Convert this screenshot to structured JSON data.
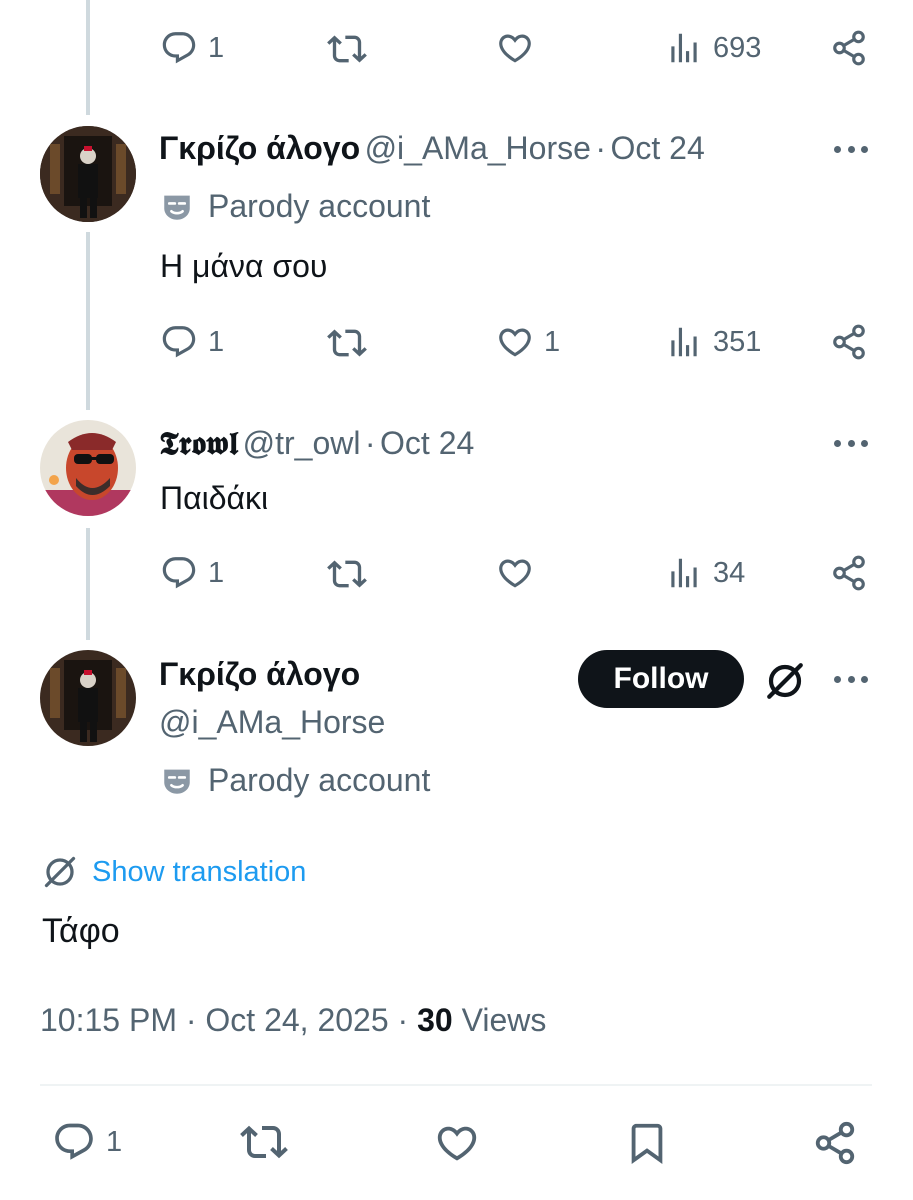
{
  "top_actions": {
    "replies": "1",
    "views": "693"
  },
  "reply1": {
    "name": "Γκρίζο άλογο",
    "handle": "@i_AMa_Horse",
    "separator": "·",
    "date": "Oct 24",
    "badge": "Parody account",
    "text": "Η μάνα σου",
    "replies": "1",
    "likes": "1",
    "views": "351"
  },
  "reply2": {
    "name": "𝕿𝖗𝖔𝖜𝖑",
    "handle": "@tr_owl",
    "separator": "·",
    "date": "Oct 24",
    "text": "Παιδάκι",
    "replies": "1",
    "views": "34"
  },
  "main": {
    "name": "Γκρίζο άλογο",
    "handle": "@i_AMa_Horse",
    "follow_label": "Follow",
    "badge": "Parody account",
    "translate_label": "Show translation",
    "text": "Τάφο",
    "time": "10:15 PM",
    "sep1": "·",
    "date": "Oct 24, 2025",
    "sep2": "·",
    "views_count": "30",
    "views_label": "Views",
    "replies": "1"
  },
  "icons": [
    "reply-icon",
    "retweet-icon",
    "like-icon",
    "views-icon",
    "share-icon",
    "more-icon",
    "parody-mask-icon",
    "grok-icon",
    "bookmark-icon"
  ],
  "colors": {
    "text": "#0f1419",
    "muted": "#536471",
    "link": "#1d9bf0",
    "line": "#cfd9de",
    "button": "#0f1419"
  }
}
